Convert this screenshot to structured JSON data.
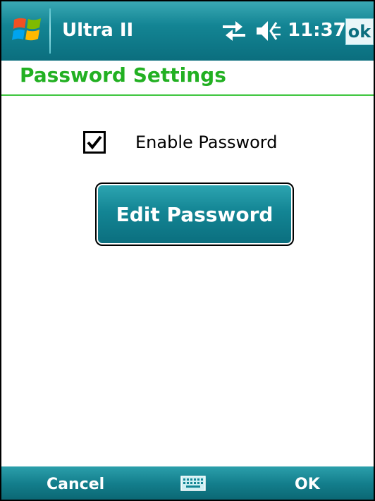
{
  "titlebar": {
    "app_name": "Ultra II",
    "time": "11:37",
    "ok_label": "ok",
    "icons": [
      "windows-start-icon",
      "connectivity-icon",
      "volume-icon"
    ]
  },
  "header": {
    "title": "Password Settings"
  },
  "settings": {
    "enable_password_label": "Enable Password",
    "enable_password_checked": true,
    "edit_button_label": "Edit Password"
  },
  "softkeys": {
    "left_label": "Cancel",
    "right_label": "OK",
    "center_icon": "keyboard-icon"
  },
  "colors": {
    "accent": "#138594",
    "title_green": "#22b022"
  }
}
